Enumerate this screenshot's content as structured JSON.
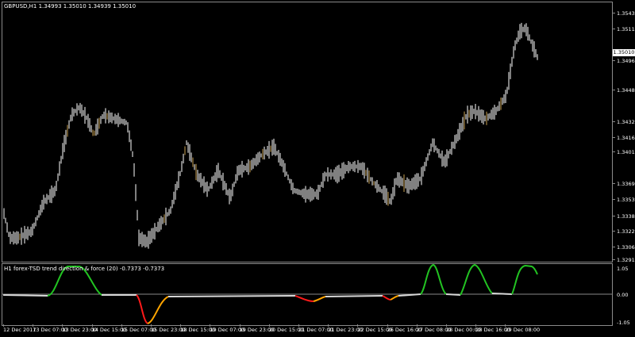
{
  "chart": {
    "symbol_header": "GBPUSD,H1  1.34993 1.35010 1.34939 1.35010",
    "current_price": "1.35010",
    "price_axis": [
      "1.35435",
      "1.35115",
      "1.34960",
      "1.34485",
      "1.34325",
      "1.34165",
      "1.34010",
      "1.33695",
      "1.33535",
      "1.33380",
      "1.33225",
      "1.33065",
      "1.32910"
    ],
    "price_range": [
      1.3291,
      1.3555
    ]
  },
  "indicator": {
    "label": "H1 forex-TSD trend direction & force (20) -0.7373 -0.7373",
    "axis": [
      "1.05",
      "0.00",
      "-1.05"
    ],
    "range": [
      -1.05,
      1.05
    ],
    "colors": {
      "up": "#22c322",
      "down": "#ff1a1a",
      "down_weak": "#ffa500",
      "flat": "#d8d8d8"
    }
  },
  "time_axis": [
    "12 Dec 2017",
    "13 Dec 07:00",
    "13 Dec 23:00",
    "14 Dec 15:00",
    "15 Dec 07:00",
    "15 Dec 23:00",
    "18 Dec 15:00",
    "19 Dec 07:00",
    "19 Dec 23:00",
    "20 Dec 15:00",
    "21 Dec 07:00",
    "21 Dec 23:00",
    "22 Dec 15:00",
    "26 Dec 16:00",
    "27 Dec 08:00",
    "28 Dec 00:00",
    "28 Dec 16:00",
    "29 Dec 08:00"
  ],
  "colors": {
    "background": "#000000",
    "grid": "#8a8a8a",
    "candle": "#ffffff",
    "candle_alt": "#c8a050"
  }
}
